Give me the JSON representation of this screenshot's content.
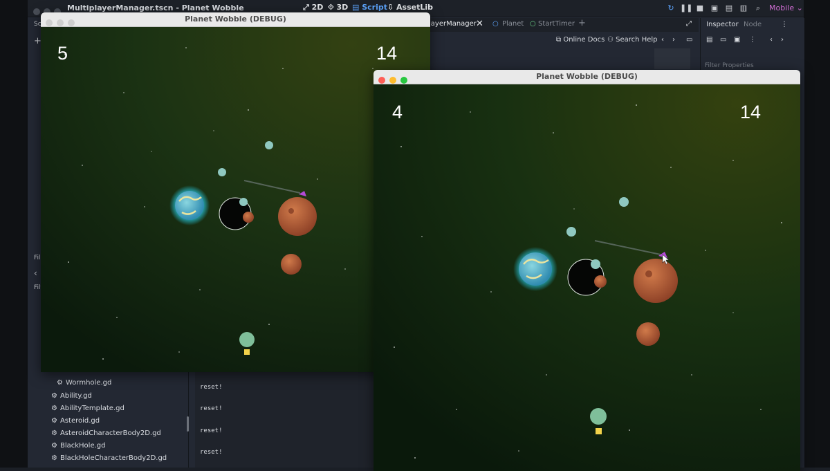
{
  "editor": {
    "title": "MultiplayerManager.tscn - Planet Wobble",
    "workspaces": [
      "2D",
      "3D",
      "Script",
      "AssetLib"
    ],
    "active_workspace": "Script",
    "renderer": "Mobile",
    "script_tabs": [
      "layerManager",
      "Planet",
      "StartTimer"
    ],
    "toolbar_links": [
      "Online Docs",
      "Search Help"
    ],
    "inspector_tabs": [
      "Inspector",
      "Node"
    ],
    "inspector_filter_placeholder": "Filter Properties",
    "dock_labels": [
      "Sc",
      "Fil",
      "Filt"
    ],
    "files": [
      "Wormhole.gd",
      "Ability.gd",
      "AbilityTemplate.gd",
      "Asteroid.gd",
      "AsteroidCharacterBody2D.gd",
      "BlackHole.gd",
      "BlackHoleCharacterBody2D.gd"
    ],
    "output_lines": [
      "reset!",
      "reset!",
      "reset!",
      "reset!"
    ]
  },
  "game_windows": [
    {
      "title": "Planet Wobble (DEBUG)",
      "score_left": "5",
      "score_right": "14",
      "focused": false
    },
    {
      "title": "Planet Wobble (DEBUG)",
      "score_left": "4",
      "score_right": "14",
      "focused": true
    }
  ],
  "colors": {
    "accent": "#5ea6ff",
    "renderer": "#d06dd4",
    "planet_glow": "#27e0ff",
    "asteroid": "#b86040",
    "space": "#14280f"
  }
}
